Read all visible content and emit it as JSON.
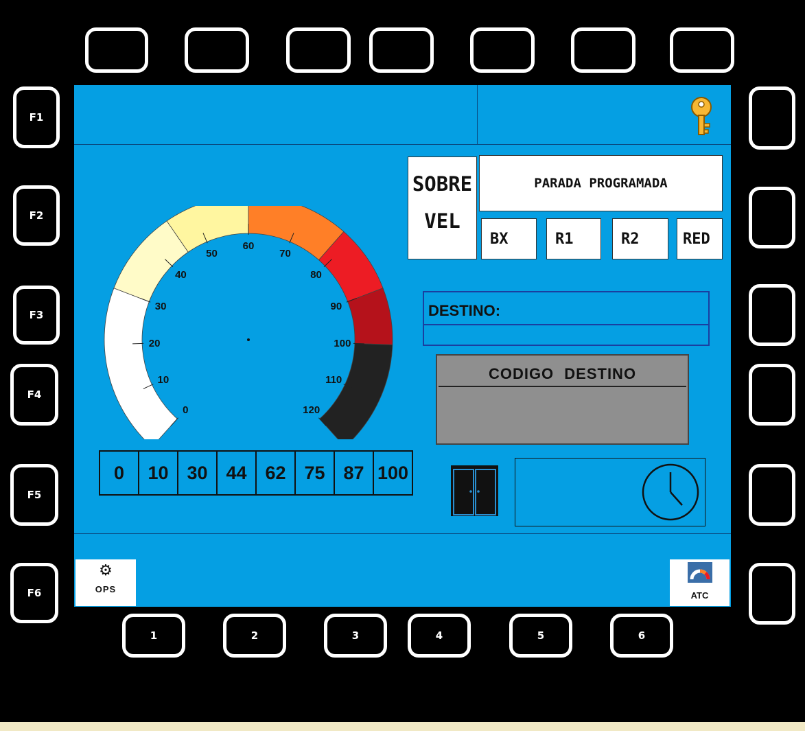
{
  "bezel": {
    "left_keys": [
      "F1",
      "F2",
      "F3",
      "F4",
      "F5",
      "F6"
    ],
    "bottom_keys": [
      "1",
      "2",
      "3",
      "4",
      "5",
      "6"
    ]
  },
  "status": {
    "overspeed_line1": "SOBRE",
    "overspeed_line2": "VEL",
    "scheduled_stop": "PARADA PROGRAMADA",
    "modes": [
      "BX",
      "R1",
      "R2",
      "RED"
    ]
  },
  "destination": {
    "label": "DESTINO:",
    "value": "",
    "code_label": "CODIGO  DESTINO",
    "code_value": ""
  },
  "speedometer": {
    "ticks": [
      "0",
      "10",
      "20",
      "30",
      "40",
      "50",
      "60",
      "70",
      "80",
      "90",
      "100",
      "110",
      "120"
    ],
    "zones": [
      {
        "from": 0,
        "to": 30,
        "color": "#ffffff"
      },
      {
        "from": 30,
        "to": 45,
        "color": "#fffbc8"
      },
      {
        "from": 45,
        "to": 60,
        "color": "#fff6a0"
      },
      {
        "from": 60,
        "to": 78,
        "color": "#ff7f27"
      },
      {
        "from": 78,
        "to": 90,
        "color": "#ed1c24"
      },
      {
        "from": 90,
        "to": 100,
        "color": "#b5121b"
      },
      {
        "from": 100,
        "to": 120,
        "color": "#222222"
      }
    ]
  },
  "speed_scale": [
    "0",
    "10",
    "30",
    "44",
    "62",
    "75",
    "87",
    "100"
  ],
  "footer": {
    "ops_label": "OPS",
    "atc_label": "ATC"
  },
  "icons": {
    "key": "key-icon",
    "door": "door-icon",
    "clock": "clock-icon",
    "gear": "gear-icon",
    "gauge": "gauge-icon"
  },
  "colors": {
    "screen": "#059fe3",
    "bezel": "#000000"
  }
}
